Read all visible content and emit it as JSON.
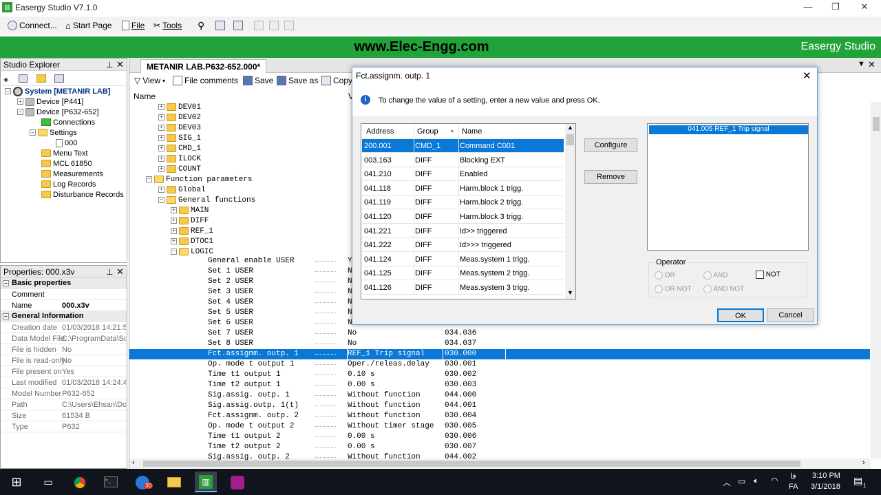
{
  "window": {
    "title": "Easergy Studio V7.1.0",
    "controls": [
      "—",
      "❐",
      "✕"
    ]
  },
  "toolbar": {
    "connect": "Connect...",
    "start_page": "Start Page",
    "file": "File",
    "tools": "Tools"
  },
  "banner": {
    "website": "www.Elec-Engg.com",
    "brand": "Easergy Studio"
  },
  "explorer": {
    "title": "Studio Explorer",
    "items": [
      {
        "label": "System [METANIR LAB]",
        "bold": true
      },
      {
        "label": "Device [P441]"
      },
      {
        "label": "Device [P632-652]"
      },
      {
        "label": "Connections"
      },
      {
        "label": "Settings"
      },
      {
        "label": "000"
      },
      {
        "label": "Menu Text"
      },
      {
        "label": "MCL 61850"
      },
      {
        "label": "Measurements"
      },
      {
        "label": "Log Records"
      },
      {
        "label": "Disturbance Records"
      }
    ]
  },
  "properties": {
    "title": "Properties: 000.x3v",
    "basic_title": "Basic properties",
    "basic": [
      {
        "k": "Comment",
        "v": ""
      },
      {
        "k": "Name",
        "v": "000.x3v"
      }
    ],
    "general_title": "General Information",
    "general": [
      {
        "k": "Creation date",
        "v": "01/03/2018 14:21:5"
      },
      {
        "k": "Data Model File",
        "v": "C:\\ProgramData\\Sch"
      },
      {
        "k": "File is hidden",
        "v": "No"
      },
      {
        "k": "File is read-only",
        "v": "No"
      },
      {
        "k": "File present on",
        "v": "Yes"
      },
      {
        "k": "Last modified",
        "v": "01/03/2018 14:24:4"
      },
      {
        "k": "Model Number",
        "v": "P632-652"
      },
      {
        "k": "Path",
        "v": "C:\\Users\\Ehsan\\Doc"
      },
      {
        "k": "Size",
        "v": "61534 B"
      },
      {
        "k": "Type",
        "v": "P632"
      }
    ]
  },
  "doc": {
    "tab": "METANIR LAB.P632-652.000*",
    "toolbar": {
      "view": "View",
      "file_comments": "File comments",
      "save": "Save",
      "save_as": "Save as",
      "copy": "Copy"
    },
    "col_name": "Name",
    "col_v": "V",
    "tree": [
      {
        "label": "DEV01",
        "lvl": 0
      },
      {
        "label": "DEV02",
        "lvl": 0
      },
      {
        "label": "DEV03",
        "lvl": 0
      },
      {
        "label": "SIG_1",
        "lvl": 0
      },
      {
        "label": "CMD_1",
        "lvl": 0
      },
      {
        "label": "ILOCK",
        "lvl": 0
      },
      {
        "label": "COUNT",
        "lvl": 0
      },
      {
        "label": "Function parameters",
        "lvl": -1,
        "open": true
      },
      {
        "label": "Global",
        "lvl": 0
      },
      {
        "label": "General functions",
        "lvl": 0,
        "open": true
      },
      {
        "label": "MAIN",
        "lvl": 1
      },
      {
        "label": "DIFF",
        "lvl": 1
      },
      {
        "label": "REF_1",
        "lvl": 1
      },
      {
        "label": "DTOC1",
        "lvl": 1
      },
      {
        "label": "LOGIC",
        "lvl": 1,
        "open": true
      }
    ],
    "rows": [
      {
        "n": "General enable USER",
        "v": "Y",
        "a": ""
      },
      {
        "n": "Set 1 USER",
        "v": "N",
        "a": ""
      },
      {
        "n": "Set 2 USER",
        "v": "N",
        "a": ""
      },
      {
        "n": "Set 3 USER",
        "v": "N",
        "a": ""
      },
      {
        "n": "Set 4 USER",
        "v": "N",
        "a": ""
      },
      {
        "n": "Set 5 USER",
        "v": "N",
        "a": ""
      },
      {
        "n": "Set 6 USER",
        "v": "N",
        "a": ""
      },
      {
        "n": "Set 7 USER",
        "v": "No",
        "a": "034.036"
      },
      {
        "n": "Set 8 USER",
        "v": "No",
        "a": "034.037"
      },
      {
        "n": "Fct.assignm. outp. 1",
        "v": "REF_1 Trip signal",
        "a": "030.000",
        "sel": true
      },
      {
        "n": "Op. mode t output 1",
        "v": "Oper./releas.delay",
        "a": "030.001"
      },
      {
        "n": "Time t1 output 1",
        "v": "0.10 s",
        "a": "030.002"
      },
      {
        "n": "Time t2 output 1",
        "v": "0.00 s",
        "a": "030.003"
      },
      {
        "n": "Sig.assig. outp. 1",
        "v": "Without function",
        "a": "044.000"
      },
      {
        "n": "Sig.assig.outp. 1(t)",
        "v": "Without function",
        "a": "044.001"
      },
      {
        "n": "Fct.assignm. outp. 2",
        "v": "Without function",
        "a": "030.004"
      },
      {
        "n": "Op. mode t output 2",
        "v": "Without timer stage",
        "a": "030.005"
      },
      {
        "n": "Time t1 output 2",
        "v": "0.00 s",
        "a": "030.006"
      },
      {
        "n": "Time t2 output 2",
        "v": "0.00 s",
        "a": "030.007"
      },
      {
        "n": "Sig.assig. outp. 2",
        "v": "Without function",
        "a": "044.002"
      }
    ]
  },
  "dialog": {
    "title": "Fct.assignm. outp. 1",
    "info": "To change the value of a setting, enter a new value and press OK.",
    "columns": {
      "address": "Address",
      "group": "Group",
      "name": "Name"
    },
    "rows": [
      {
        "a": "200.001",
        "g": "CMD_1",
        "n": "Command C001",
        "sel": true
      },
      {
        "a": "003.163",
        "g": "DIFF",
        "n": "Blocking EXT"
      },
      {
        "a": "041.210",
        "g": "DIFF",
        "n": "Enabled"
      },
      {
        "a": "041.118",
        "g": "DIFF",
        "n": "Harm.block 1 trigg."
      },
      {
        "a": "041.119",
        "g": "DIFF",
        "n": "Harm.block 2 trigg."
      },
      {
        "a": "041.120",
        "g": "DIFF",
        "n": "Harm.block 3 trigg."
      },
      {
        "a": "041.221",
        "g": "DIFF",
        "n": "Id>> triggered"
      },
      {
        "a": "041.222",
        "g": "DIFF",
        "n": "Id>>> triggered"
      },
      {
        "a": "041.124",
        "g": "DIFF",
        "n": "Meas.system 1 trigg."
      },
      {
        "a": "041.125",
        "g": "DIFF",
        "n": "Meas.system 2 trigg."
      },
      {
        "a": "041.126",
        "g": "DIFF",
        "n": "Meas.system 3 trigg."
      }
    ],
    "configure": "Configure",
    "remove": "Remove",
    "selected": "041.005 REF_1 Trip signal",
    "operator": {
      "title": "Operator",
      "or": "OR",
      "and": "AND",
      "not": "NOT",
      "or_not": "OR NOT",
      "and_not": "AND NOT"
    },
    "ok": "OK",
    "cancel": "Cancel"
  },
  "taskbar": {
    "time": "3:10 PM",
    "date": "3/1/2018",
    "lang": "FA",
    "lang2": "فا",
    "badge": "30",
    "notif": "1"
  }
}
